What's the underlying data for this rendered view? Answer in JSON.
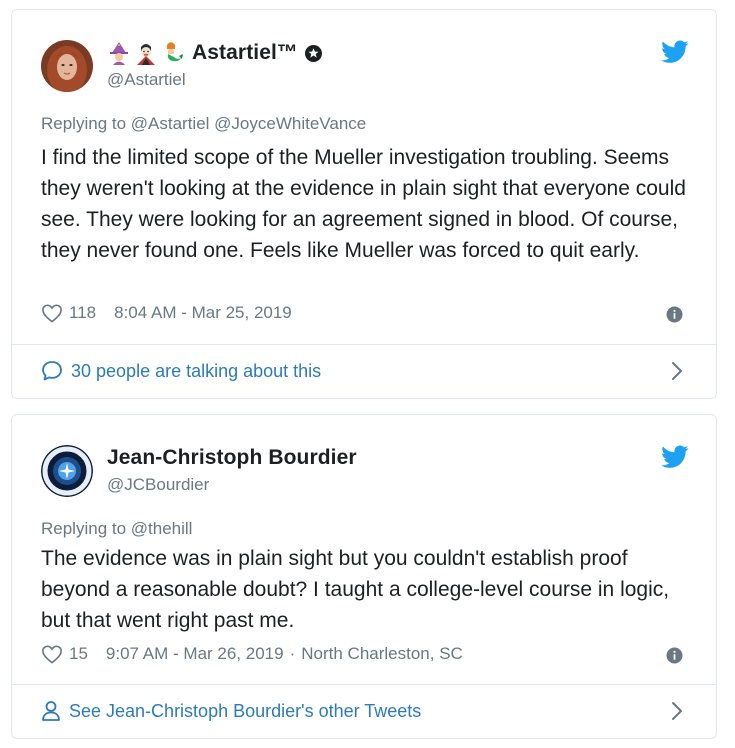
{
  "colors": {
    "link": "#2b7bb9",
    "secondary_text": "#697882",
    "text": "#1c2022",
    "twitter_blue": "#1da1f2",
    "border": "#e1e8ed"
  },
  "tweets": [
    {
      "display_name": "Astartiel™",
      "emoji_icons": [
        "woman-mage-emoji",
        "vampire-emoji",
        "mermaid-emoji"
      ],
      "handle": "@Astartiel",
      "replying_to": "Replying to @Astartiel @JoyceWhiteVance",
      "text": "I find the limited scope of the Mueller investigation troubling. Seems they weren't looking at the evidence in plain sight that everyone could see. They were looking for an agreement signed in blood. Of course, they never found one. Feels like Mueller was forced to quit early.",
      "likes": "118",
      "timestamp": "8:04 AM - Mar 25, 2019",
      "footer_icon": "speech-bubble-icon",
      "footer_text": "30 people are talking about this"
    },
    {
      "display_name": "Jean-Christoph Bourdier",
      "handle": "@JCBourdier",
      "replying_to": "Replying to @thehill",
      "text": "The evidence was in plain sight but you couldn't establish proof beyond a reasonable doubt? I taught a college-level course in logic, but that went right past me.",
      "likes": "15",
      "timestamp": "9:07 AM - Mar 26, 2019",
      "location": "North Charleston, SC",
      "footer_icon": "person-icon",
      "footer_text": "See Jean-Christoph Bourdier's other Tweets"
    }
  ]
}
